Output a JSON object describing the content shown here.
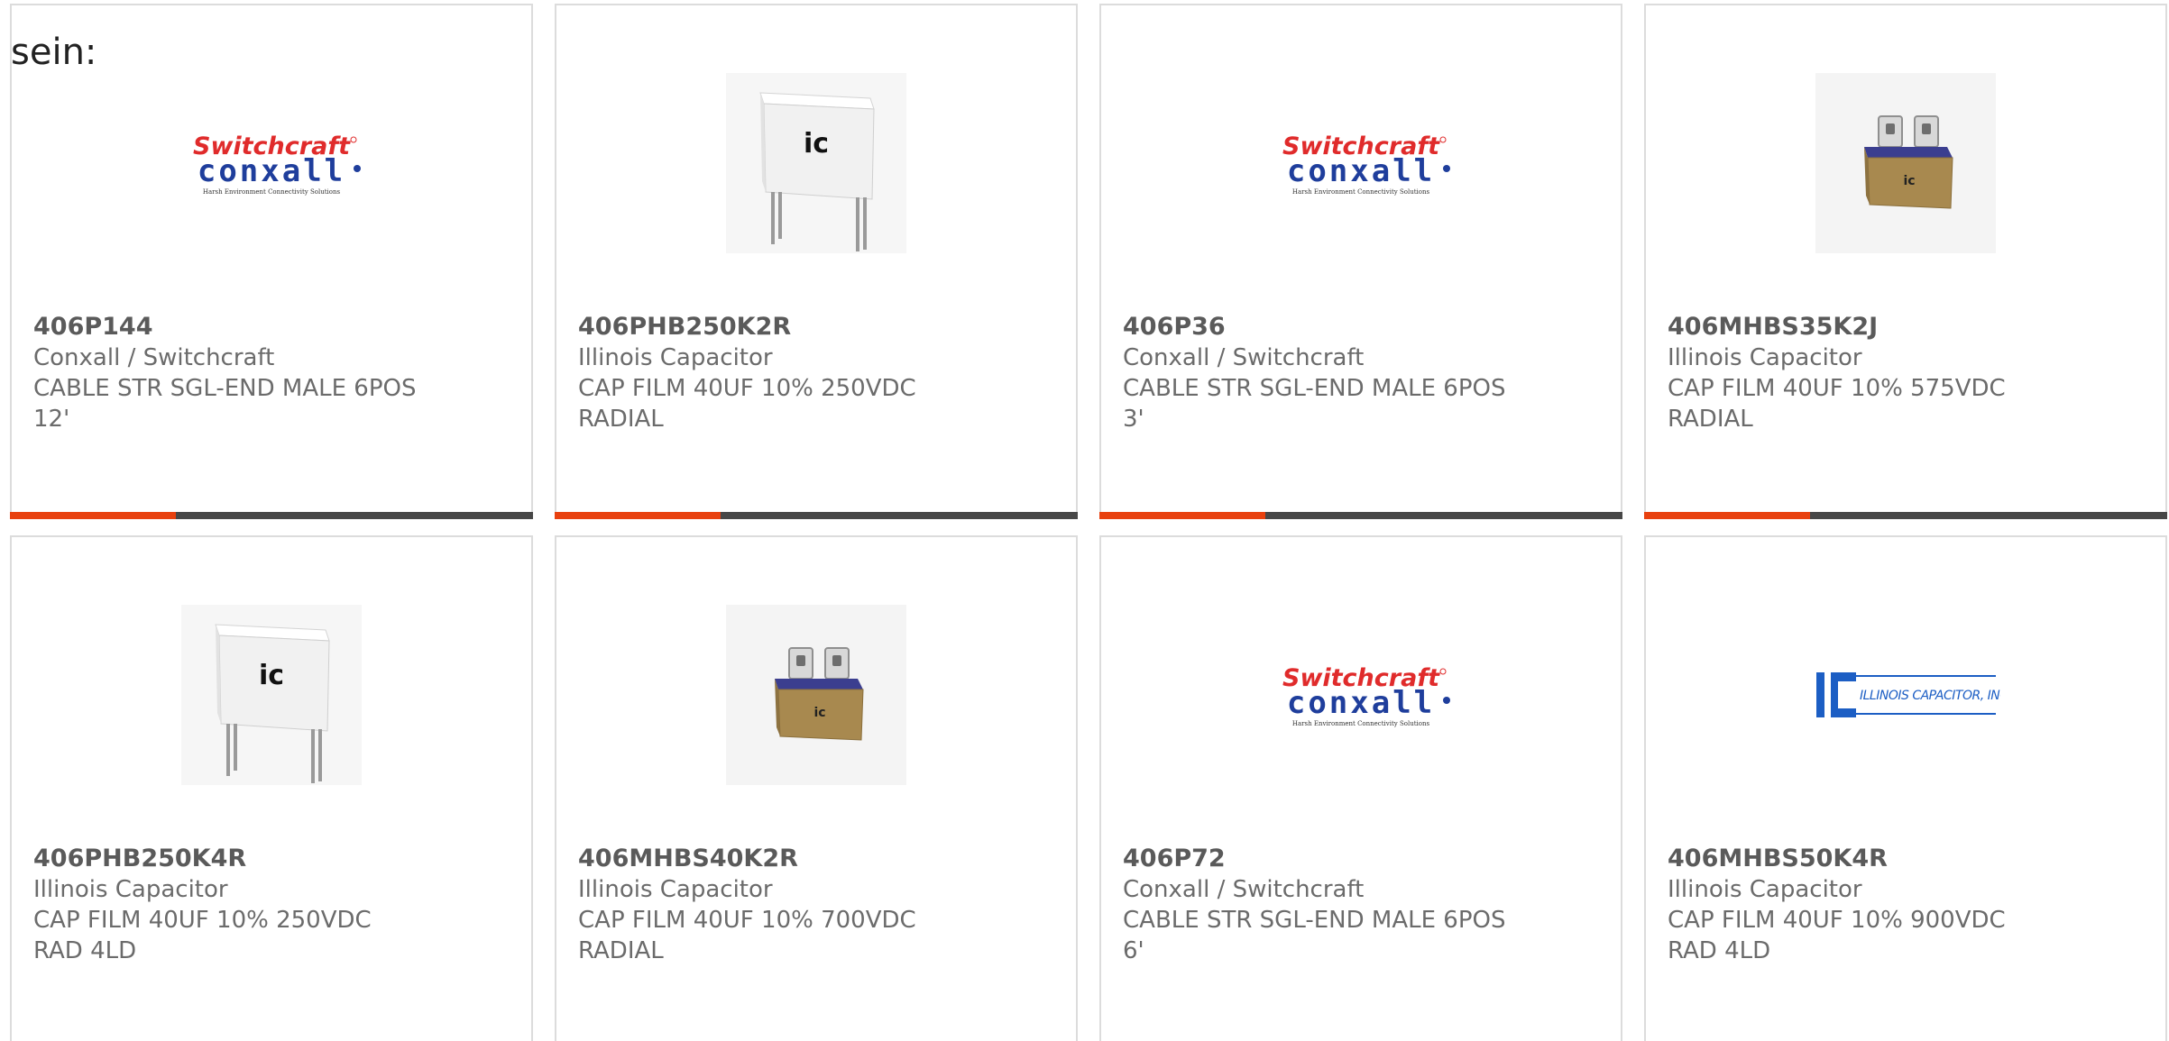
{
  "fragment_text": "sein:",
  "colors": {
    "accent": "#e8410f",
    "bar": "#474747",
    "border": "#dcdcdc",
    "switchcraft_red": "#e02b2b",
    "conxall_blue": "#1f3e9c",
    "ic_blue": "#1c5ec4"
  },
  "cards": [
    {
      "part_number": "406P144",
      "manufacturer": "Conxall / Switchcraft",
      "description_line1": "CABLE STR SGL-END MALE 6POS",
      "description_line2": "12'",
      "image_type": "switchcraft-conxall-logo",
      "logo_top": "Switchcraft",
      "logo_bottom": "conxall",
      "logo_tagline": "Harsh Environment Connectivity Solutions"
    },
    {
      "part_number": "406PHB250K2R",
      "manufacturer": "Illinois Capacitor",
      "description_line1": "CAP FILM 40UF 10% 250VDC",
      "description_line2": "RADIAL",
      "image_type": "white-radial-capacitor"
    },
    {
      "part_number": "406P36",
      "manufacturer": "Conxall / Switchcraft",
      "description_line1": "CABLE STR SGL-END MALE 6POS",
      "description_line2": "3'",
      "image_type": "switchcraft-conxall-logo",
      "logo_top": "Switchcraft",
      "logo_bottom": "conxall",
      "logo_tagline": "Harsh Environment Connectivity Solutions"
    },
    {
      "part_number": "406MHBS35K2J",
      "manufacturer": "Illinois Capacitor",
      "description_line1": "CAP FILM 40UF 10% 575VDC",
      "description_line2": "RADIAL",
      "image_type": "brown-box-capacitor"
    },
    {
      "part_number": "406PHB250K4R",
      "manufacturer": "Illinois Capacitor",
      "description_line1": "CAP FILM 40UF 10% 250VDC",
      "description_line2": "RAD 4LD",
      "image_type": "white-radial-capacitor"
    },
    {
      "part_number": "406MHBS40K2R",
      "manufacturer": "Illinois Capacitor",
      "description_line1": "CAP FILM 40UF 10% 700VDC",
      "description_line2": "RADIAL",
      "image_type": "brown-box-capacitor"
    },
    {
      "part_number": "406P72",
      "manufacturer": "Conxall / Switchcraft",
      "description_line1": "CABLE STR SGL-END MALE 6POS",
      "description_line2": "6'",
      "image_type": "switchcraft-conxall-logo",
      "logo_top": "Switchcraft",
      "logo_bottom": "conxall",
      "logo_tagline": "Harsh Environment Connectivity Solutions"
    },
    {
      "part_number": "406MHBS50K4R",
      "manufacturer": "Illinois Capacitor",
      "description_line1": "CAP FILM 40UF 10% 900VDC",
      "description_line2": "RAD 4LD",
      "image_type": "illinois-capacitor-logo",
      "logo_text": "ILLINOIS CAPACITOR, INC."
    }
  ]
}
